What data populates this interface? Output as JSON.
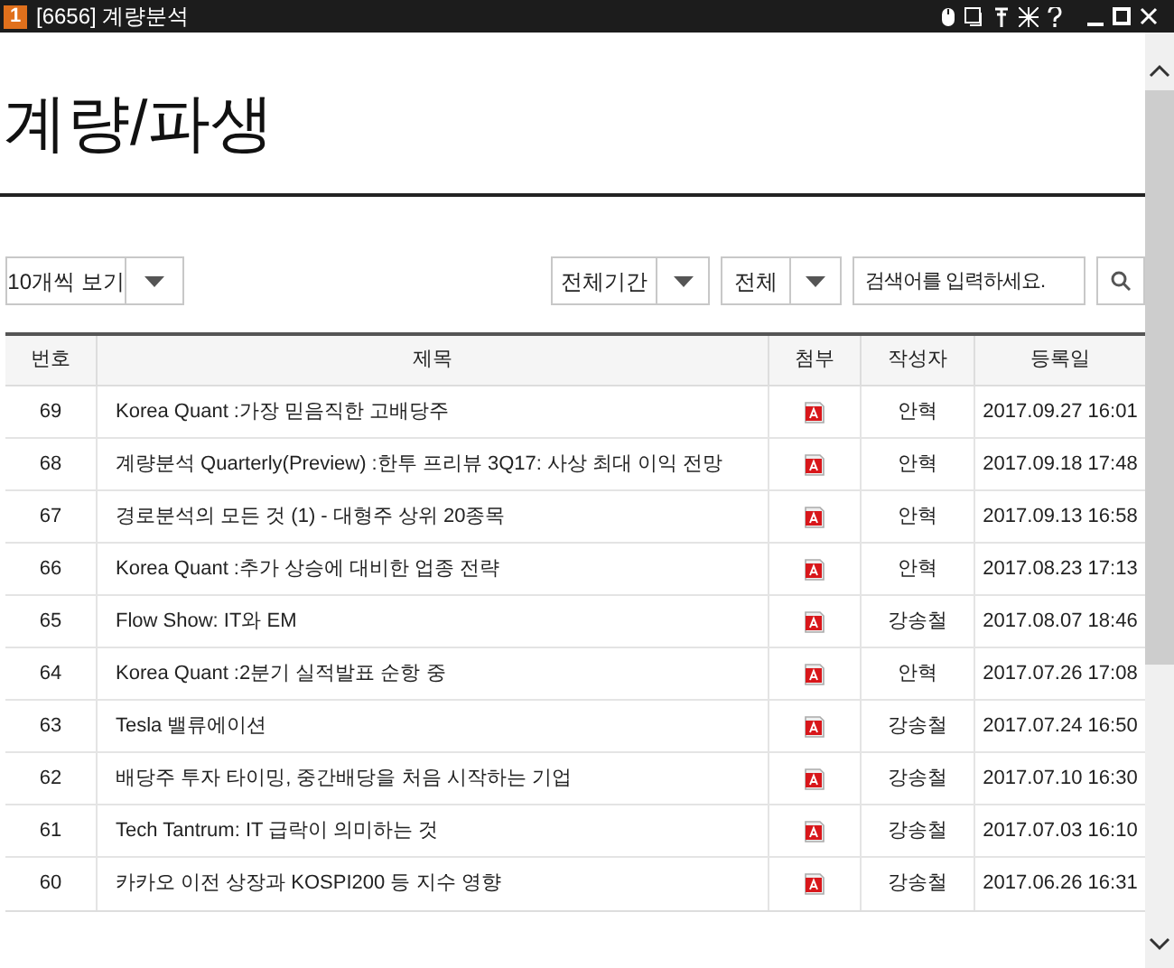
{
  "window": {
    "badge": "1",
    "title": "[6656] 계량분석"
  },
  "heading": "계량/파생",
  "page_size_select": {
    "value": "10개씩 보기"
  },
  "period_select": {
    "value": "전체기간"
  },
  "field_select": {
    "value": "전체"
  },
  "search": {
    "placeholder": "검색어를 입력하세요."
  },
  "table": {
    "columns": [
      "번호",
      "제목",
      "첨부",
      "작성자",
      "등록일"
    ],
    "rows": [
      {
        "no": "69",
        "title": "Korea Quant :가장 믿음직한 고배당주",
        "attachment": true,
        "author": "안혁",
        "date": "2017.09.27 16:01"
      },
      {
        "no": "68",
        "title": "계량분석 Quarterly(Preview) :한투 프리뷰 3Q17: 사상 최대 이익 전망",
        "attachment": true,
        "author": "안혁",
        "date": "2017.09.18 17:48"
      },
      {
        "no": "67",
        "title": "경로분석의 모든 것 (1) - 대형주 상위 20종목",
        "attachment": true,
        "author": "안혁",
        "date": "2017.09.13 16:58"
      },
      {
        "no": "66",
        "title": "Korea Quant :추가 상승에 대비한 업종 전략",
        "attachment": true,
        "author": "안혁",
        "date": "2017.08.23 17:13"
      },
      {
        "no": "65",
        "title": "Flow Show: IT와 EM",
        "attachment": true,
        "author": "강송철",
        "date": "2017.08.07 18:46"
      },
      {
        "no": "64",
        "title": "Korea Quant :2분기 실적발표 순항 중",
        "attachment": true,
        "author": "안혁",
        "date": "2017.07.26 17:08"
      },
      {
        "no": "63",
        "title": "Tesla 밸류에이션",
        "attachment": true,
        "author": "강송철",
        "date": "2017.07.24 16:50"
      },
      {
        "no": "62",
        "title": "배당주 투자 타이밍, 중간배당을 처음 시작하는 기업",
        "attachment": true,
        "author": "강송철",
        "date": "2017.07.10 16:30"
      },
      {
        "no": "61",
        "title": "Tech Tantrum: IT 급락이 의미하는 것",
        "attachment": true,
        "author": "강송철",
        "date": "2017.07.03 16:10"
      },
      {
        "no": "60",
        "title": "카카오 이전 상장과 KOSPI200 등 지수 영향",
        "attachment": true,
        "author": "강송철",
        "date": "2017.06.26 16:31"
      }
    ]
  }
}
